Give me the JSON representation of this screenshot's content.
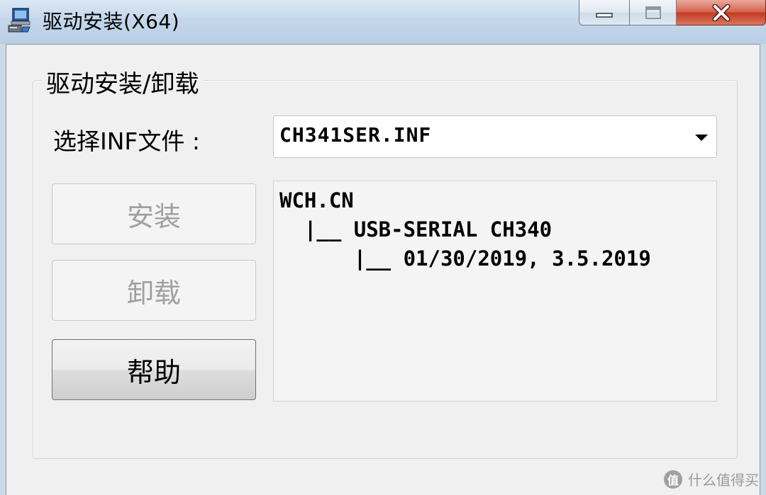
{
  "window": {
    "title": "驱动安装(X64)",
    "icon": "computer-installer-icon",
    "controls": {
      "minimize": "minimize-icon",
      "maximize": "maximize-icon",
      "close": "close-icon"
    }
  },
  "group": {
    "legend": "驱动安装/卸载"
  },
  "inf_selector": {
    "label": "选择INF文件 :",
    "value": "CH341SER.INF"
  },
  "buttons": {
    "install": "安装",
    "uninstall": "卸载",
    "help": "帮助"
  },
  "driver_info": {
    "lines": [
      "WCH.CN",
      "  |__ USB-SERIAL CH340",
      "      |__ 01/30/2019, 3.5.2019"
    ]
  },
  "watermark": {
    "text": "什么值得买",
    "logo_glyph": "值"
  },
  "colors": {
    "close_button": "#c43a22",
    "disabled_text": "#a0a0a0",
    "client_background": "#f0f0f0"
  }
}
